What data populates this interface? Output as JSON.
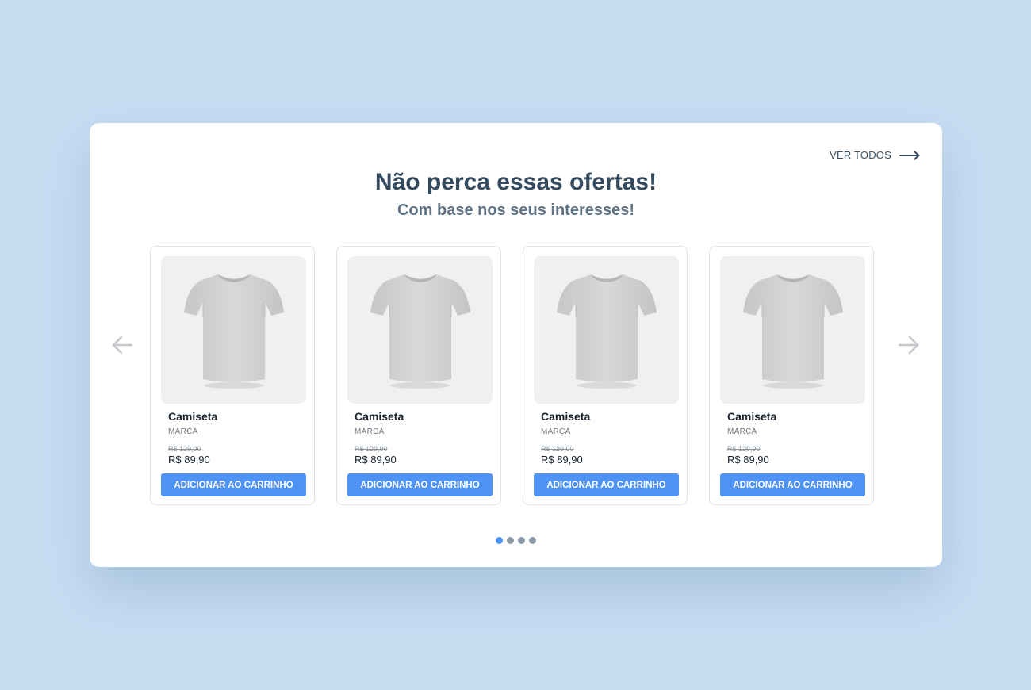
{
  "section": {
    "title": "Não perca essas ofertas!",
    "subtitle": "Com base nos seus interesses!",
    "see_all_label": "VER TODOS"
  },
  "products": [
    {
      "name": "Camiseta",
      "brand": "MARCA",
      "old_price": "R$ 129,90",
      "price": "R$ 89,90",
      "button_label": "ADICIONAR AO CARRINHO",
      "image": "white-tshirt"
    },
    {
      "name": "Camiseta",
      "brand": "MARCA",
      "old_price": "R$ 129,90",
      "price": "R$ 89,90",
      "button_label": "ADICIONAR AO CARRINHO",
      "image": "white-tshirt"
    },
    {
      "name": "Camiseta",
      "brand": "MARCA",
      "old_price": "R$ 129,90",
      "price": "R$ 89,90",
      "button_label": "ADICIONAR AO CARRINHO",
      "image": "white-tshirt"
    },
    {
      "name": "Camiseta",
      "brand": "MARCA",
      "old_price": "R$ 129,90",
      "price": "R$ 89,90",
      "button_label": "ADICIONAR AO CARRINHO",
      "image": "white-tshirt"
    }
  ],
  "carousel": {
    "page_count": 4,
    "active_page": 1,
    "prev_icon": "arrow-left-icon",
    "next_icon": "arrow-right-icon"
  },
  "colors": {
    "background": "#c6dcf1",
    "accent": "#4f93f4",
    "title": "#344a5e",
    "subtitle": "#5f7385",
    "dot_inactive": "#8a9aa8"
  }
}
